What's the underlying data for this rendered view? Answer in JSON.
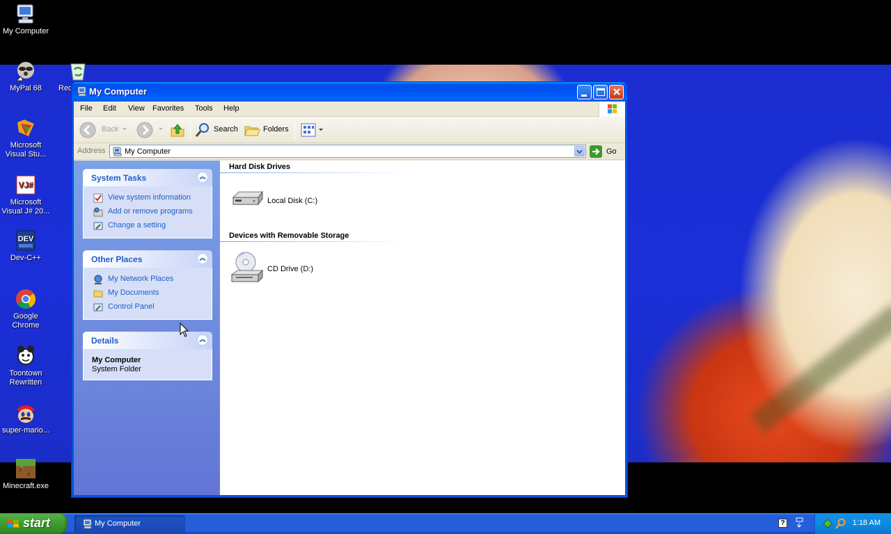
{
  "desktop": {
    "icons": [
      {
        "label": "My Computer"
      },
      {
        "label": "MyPal 68"
      },
      {
        "label": "Rec"
      },
      {
        "label": "Microsoft Visual Stu..."
      },
      {
        "label": "Microsoft Visual J# 20..."
      },
      {
        "label": "Dev-C++"
      },
      {
        "label": "Google Chrome"
      },
      {
        "label": "Toontown Rewritten"
      },
      {
        "label": "super-mario..."
      },
      {
        "label": "Minecraft.exe"
      }
    ]
  },
  "window": {
    "title": "My Computer",
    "menu": [
      "File",
      "Edit",
      "View",
      "Favorites",
      "Tools",
      "Help"
    ],
    "toolbar": {
      "back_label": "Back",
      "search_label": "Search",
      "folders_label": "Folders"
    },
    "address": {
      "label": "Address",
      "value": "My Computer",
      "go_label": "Go"
    },
    "left_pane": {
      "system_tasks": {
        "title": "System Tasks",
        "items": [
          "View system information",
          "Add or remove programs",
          "Change a setting"
        ]
      },
      "other_places": {
        "title": "Other Places",
        "items": [
          "My Network Places",
          "My Documents",
          "Control Panel"
        ]
      },
      "details": {
        "title": "Details",
        "name": "My Computer",
        "type": "System Folder"
      }
    },
    "content": {
      "groups": [
        {
          "title": "Hard Disk Drives",
          "items": [
            "Local Disk (C:)"
          ]
        },
        {
          "title": "Devices with Removable Storage",
          "items": [
            "CD Drive (D:)"
          ]
        }
      ]
    }
  },
  "taskbar": {
    "start_label": "start",
    "task_button_label": "My Computer",
    "clock": "1:18 AM"
  }
}
